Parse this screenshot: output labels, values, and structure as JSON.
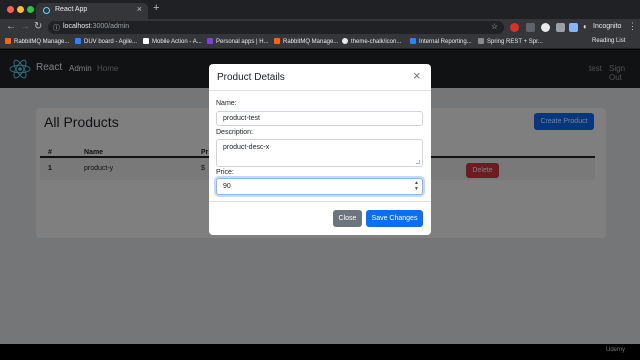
{
  "browser": {
    "tab_title": "React App",
    "tab_close": "×",
    "new_tab": "+",
    "url_host": "localhost",
    "url_path": ":3000/admin",
    "incognito_label": "Incognito",
    "back": "←",
    "forward": "→",
    "reload": "↻",
    "lock": "ⓘ",
    "star": "☆",
    "menu": "⋮",
    "bookmarks": [
      {
        "label": "RabbitMQ Manage...",
        "color": "#ff6600"
      },
      {
        "label": "DUV board - Agile...",
        "color": "#2684ff"
      },
      {
        "label": "Mobile Action - A...",
        "color": "#ffffff"
      },
      {
        "label": "Personal apps | H...",
        "color": "#7b3fe4"
      },
      {
        "label": "RabbitMQ Manage...",
        "color": "#ff6600"
      },
      {
        "label": "theme-chalk/icon...",
        "color": "#e8eaed"
      },
      {
        "label": "Internal Reporting...",
        "color": "#2684ff"
      },
      {
        "label": "Spring REST + Spr...",
        "color": "#8a8a8a"
      }
    ],
    "reading_list": "Reading List"
  },
  "app_nav": {
    "brand": "React",
    "admin": "Admin",
    "home": "Home",
    "user": "test",
    "signout": "Sign Out"
  },
  "products": {
    "title": "All Products",
    "create_button": "Create Product",
    "columns": [
      "#",
      "Name",
      "Pr"
    ],
    "rows": [
      {
        "num": "1",
        "name": "product-y",
        "price": "$",
        "action": "Delete"
      }
    ]
  },
  "modal": {
    "title": "Product Details",
    "close_icon": "×",
    "name_label": "Name:",
    "name_value": "product-test",
    "description_label": "Description:",
    "description_value": "product-desc-x",
    "price_label": "Price:",
    "price_value": "90",
    "close_button": "Close",
    "save_button": "Save Changes"
  },
  "watermark": "Udemy",
  "colors": {
    "primary": "#0d6efd",
    "danger": "#dc3545",
    "secondary": "#6c757d",
    "navbar": "#212529"
  }
}
